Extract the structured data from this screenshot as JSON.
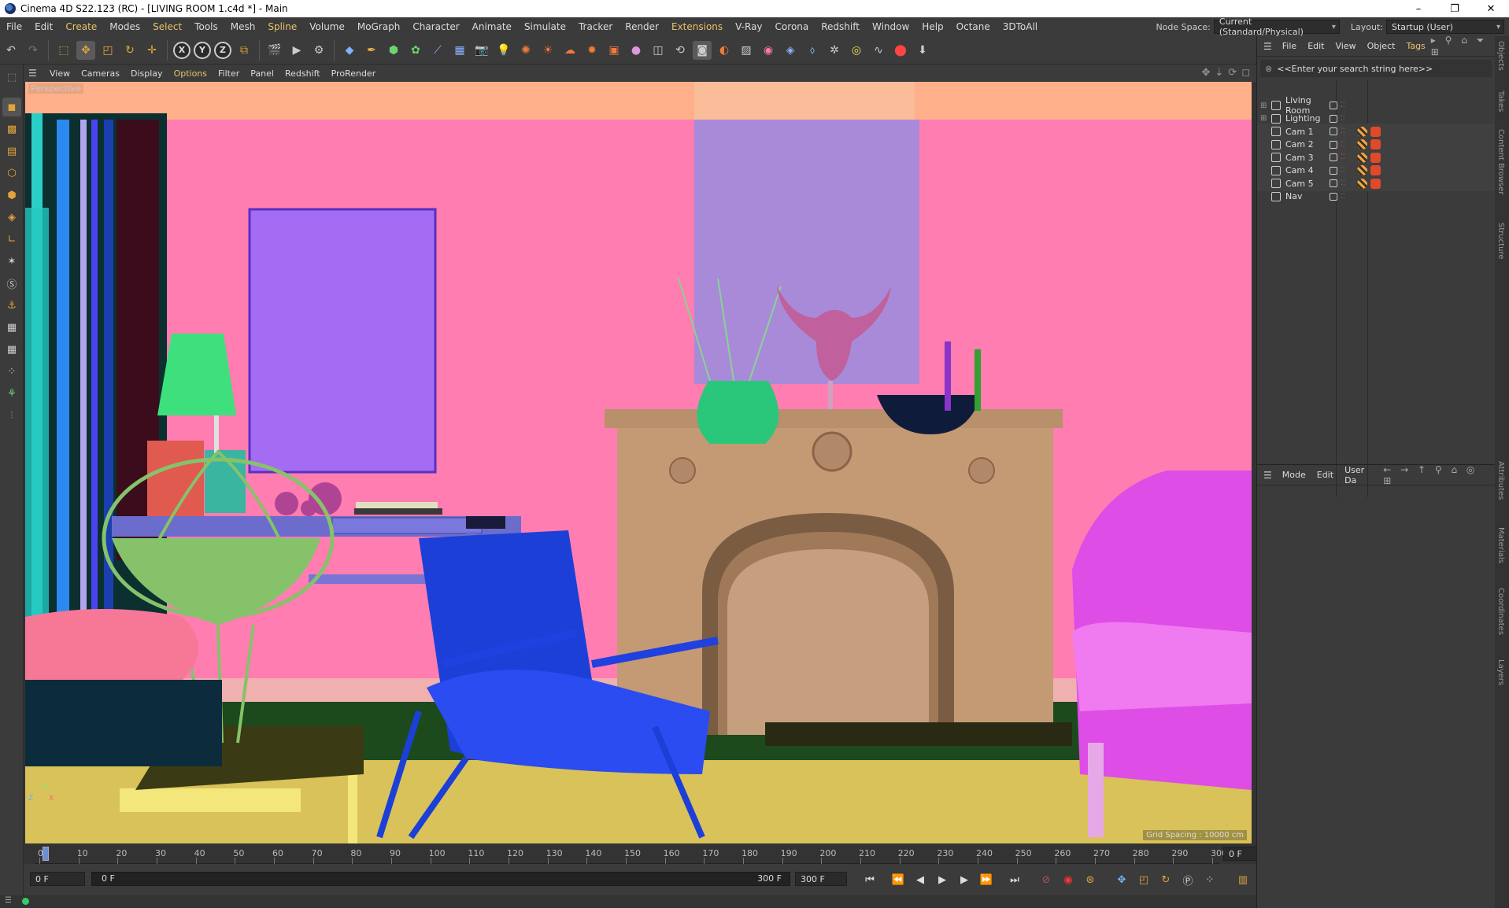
{
  "window": {
    "title": "Cinema 4D S22.123 (RC) - [LIVING ROOM 1.c4d *] - Main",
    "controls": {
      "minimize": "–",
      "maximize": "❐",
      "close": "✕"
    }
  },
  "menubar": {
    "items": [
      "File",
      "Edit",
      "Create",
      "Modes",
      "Select",
      "Tools",
      "Mesh",
      "Spline",
      "Volume",
      "MoGraph",
      "Character",
      "Animate",
      "Simulate",
      "Tracker",
      "Render",
      "Extensions",
      "V-Ray",
      "Corona",
      "Redshift",
      "Window",
      "Help",
      "Octane",
      "3DToAll"
    ],
    "highlighted": [
      "Create",
      "Select",
      "Spline",
      "Extensions"
    ],
    "node_space_label": "Node Space:",
    "node_space_value": "Current (Standard/Physical)",
    "layout_label": "Layout:",
    "layout_value": "Startup (User)"
  },
  "viewport": {
    "menu": [
      "View",
      "Cameras",
      "Display",
      "Options",
      "Filter",
      "Panel",
      "Redshift",
      "ProRender"
    ],
    "highlighted": "Options",
    "label": "Perspective",
    "grid_spacing": "Grid Spacing : 10000 cm",
    "axis_z": "Z",
    "axis_x": "X",
    "axis_y": "Y"
  },
  "timeline": {
    "ticks": [
      "0",
      "10",
      "20",
      "30",
      "40",
      "50",
      "60",
      "70",
      "80",
      "90",
      "100",
      "110",
      "120",
      "130",
      "140",
      "150",
      "160",
      "170",
      "180",
      "190",
      "200",
      "210",
      "220",
      "230",
      "240",
      "250",
      "260",
      "270",
      "280",
      "290",
      "300"
    ],
    "current_frame_right": "0 F",
    "start_frame": "0 F",
    "range_start": "0 F",
    "range_end": "300 F",
    "end_frame": "300 F"
  },
  "objects_panel": {
    "menu": [
      "File",
      "Edit",
      "View",
      "Object",
      "Tags"
    ],
    "search_placeholder": "<<Enter your search string here>>",
    "rows": [
      "Living Room",
      "Lighting",
      "Cam 1",
      "Cam 2",
      "Cam 3",
      "Cam 4",
      "Cam 5",
      "Nav"
    ]
  },
  "attributes_panel": {
    "menu": [
      "Mode",
      "Edit",
      "User Da"
    ]
  },
  "side_tabs": {
    "top": [
      "Objects",
      "Takes",
      "Content Browser",
      "Structure"
    ],
    "bottom": [
      "Attributes",
      "Materials",
      "Coordinates",
      "Layers"
    ]
  },
  "colors": {
    "wall": "#ff7db1",
    "ceiling": "#ffb08a",
    "frame_left": "#a36cf2",
    "frame_right": "#a88ad8",
    "fireplace": "#c49a74",
    "chair_blue": "#1c3fd8",
    "armchair": "#de4de6",
    "lamp": "#3de07d",
    "wire_chair": "#86c26a",
    "floor": "#1c4a1c",
    "rug": "#d8c259",
    "bull": "#c0609c",
    "accent": "#e8c36a"
  }
}
